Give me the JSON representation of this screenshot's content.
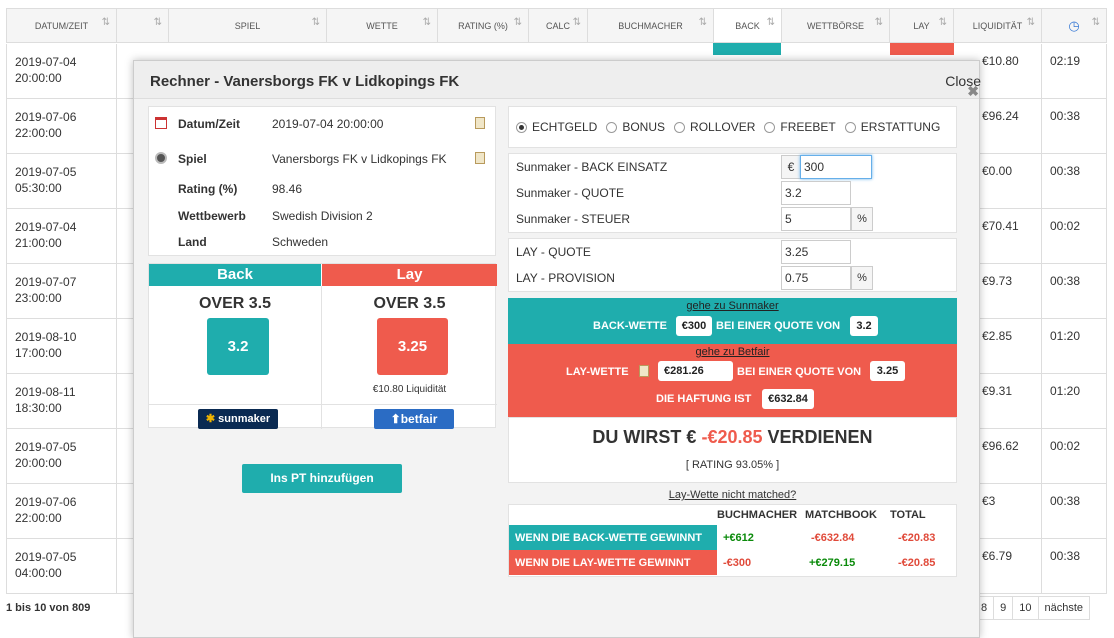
{
  "table": {
    "headers": [
      "DATUM/ZEIT",
      "",
      "SPIEL",
      "WETTE",
      "RATING (%)",
      "CALC",
      "BUCHMACHER",
      "BACK",
      "WETTBÖRSE",
      "LAY",
      "LIQUIDITÄT",
      ""
    ],
    "rows": [
      {
        "date": "2019-07-04",
        "time": "20:00:00",
        "liq": "€10.80",
        "t": "02:19"
      },
      {
        "date": "2019-07-06",
        "time": "22:00:00",
        "liq": "€96.24",
        "t": "00:38"
      },
      {
        "date": "2019-07-05",
        "time": "05:30:00",
        "liq": "€0.00",
        "t": "00:38"
      },
      {
        "date": "2019-07-04",
        "time": "21:00:00",
        "liq": "€70.41",
        "t": "00:02"
      },
      {
        "date": "2019-07-07",
        "time": "23:00:00",
        "liq": "€9.73",
        "t": "00:38"
      },
      {
        "date": "2019-08-10",
        "time": "17:00:00",
        "liq": "€2.85",
        "t": "01:20"
      },
      {
        "date": "2019-08-11",
        "time": "18:30:00",
        "liq": "€9.31",
        "t": "01:20"
      },
      {
        "date": "2019-07-05",
        "time": "20:00:00",
        "liq": "€96.62",
        "t": "00:02"
      },
      {
        "date": "2019-07-06",
        "time": "22:00:00",
        "liq": "€3",
        "t": "00:38"
      },
      {
        "date": "2019-07-05",
        "time": "04:00:00",
        "liq": "€6.79",
        "t": "00:38"
      }
    ],
    "footer": "1 bis 10 von 809",
    "pages": [
      "8",
      "9",
      "10",
      "nächste"
    ]
  },
  "modal": {
    "title": "Rechner - Vanersborgs FK v Lidkopings FK",
    "close": "Close",
    "info": {
      "datum_label": "Datum/Zeit",
      "datum": "2019-07-04 20:00:00",
      "spiel_label": "Spiel",
      "spiel": "Vanersborgs FK v Lidkopings FK",
      "rating_label": "Rating (%)",
      "rating": "98.46",
      "wettbewerb_label": "Wettbewerb",
      "wettbewerb": "Swedish Division 2",
      "land_label": "Land",
      "land": "Schweden"
    },
    "back": {
      "header": "Back",
      "market": "OVER 3.5",
      "odds": "3.2",
      "brand": "sunmaker"
    },
    "lay": {
      "header": "Lay",
      "market": "OVER 3.5",
      "odds": "3.25",
      "liquidity": "€10.80 Liquidität",
      "brand": "betfair"
    },
    "add_button": "Ins PT hinzufügen",
    "radios": [
      "ECHTGELD",
      "BONUS",
      "ROLLOVER",
      "FREEBET",
      "ERSTATTUNG"
    ],
    "fields": {
      "back_stake_label": "Sunmaker - BACK EINSATZ",
      "currency": "€",
      "back_stake": "300",
      "back_odds_label": "Sunmaker - QUOTE",
      "back_odds": "3.2",
      "tax_label": "Sunmaker - STEUER",
      "tax": "5",
      "pct": "%",
      "lay_odds_label": "LAY - QUOTE",
      "lay_odds": "3.25",
      "commission_label": "LAY - PROVISION",
      "commission": "0.75"
    },
    "back_bar": {
      "link": "gehe zu Sunmaker",
      "label1": "BACK-WETTE",
      "stake": "€300",
      "label2": "BEI EINER QUOTE VON",
      "odds": "3.2"
    },
    "lay_bar": {
      "link": "gehe zu Betfair",
      "label1": "LAY-WETTE",
      "stake": "€281.26",
      "label2": "BEI EINER QUOTE VON",
      "odds": "3.25",
      "liab_label": "DIE HAFTUNG IST",
      "liab": "€632.84"
    },
    "result": {
      "pre": "DU WIRST €",
      "amount": "-€20.85",
      "post": "VERDIENEN",
      "rating": "[ RATING 93.05% ]"
    },
    "not_matched": "Lay-Wette nicht matched?",
    "outcome": {
      "cols": [
        "BUCHMACHER",
        "MATCHBOOK",
        "TOTAL"
      ],
      "back_win": {
        "label": "WENN DIE BACK-WETTE GEWINNT",
        "b": "+€612",
        "m": "-€632.84",
        "t": "-€20.83"
      },
      "lay_win": {
        "label": "WENN DIE LAY-WETTE GEWINNT",
        "b": "-€300",
        "m": "+€279.15",
        "t": "-€20.85"
      }
    }
  },
  "colors": {
    "teal": "#1fadad",
    "red": "#ef5b4d"
  }
}
